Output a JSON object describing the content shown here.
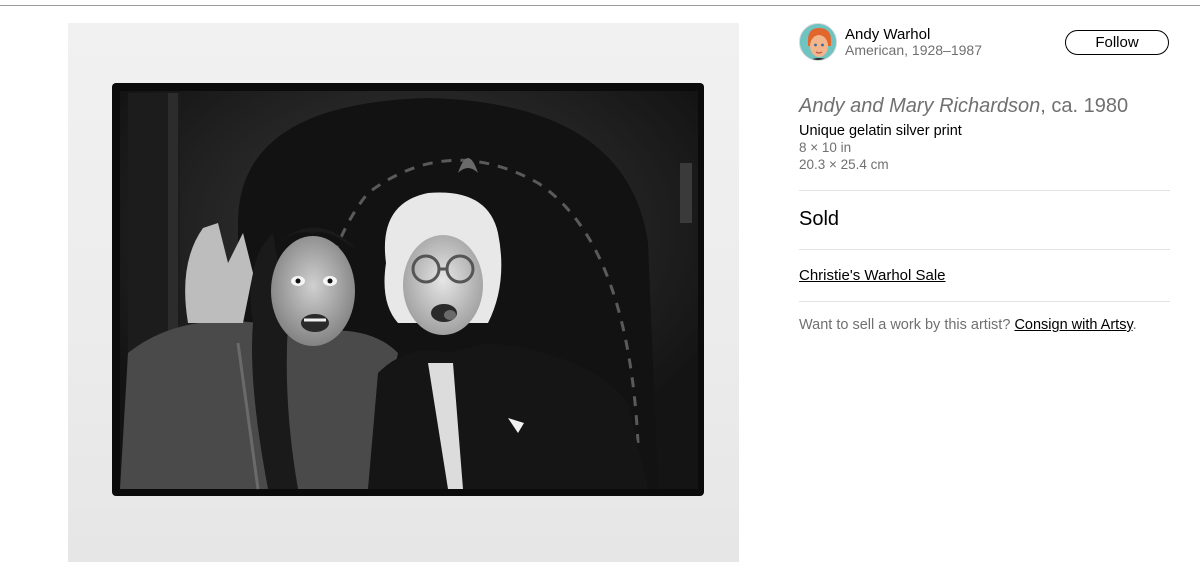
{
  "artist": {
    "name": "Andy Warhol",
    "meta": "American, 1928–1987",
    "follow_label": "Follow"
  },
  "artwork": {
    "title": "Andy and Mary Richardson",
    "date_text": ", ca. 1980",
    "medium": "Unique gelatin silver print",
    "dimensions_in": "8 × 10 in",
    "dimensions_cm": "20.3 × 25.4 cm",
    "status": "Sold",
    "sale_link": "Christie's Warhol Sale"
  },
  "consign": {
    "prompt": "Want to sell a work by this artist? ",
    "link": "Consign with Artsy",
    "suffix": "."
  },
  "colors": {
    "text_primary": "#000000",
    "text_secondary": "#707070",
    "divider": "#e2e2e2",
    "avatar_bg": "#6fc3c0"
  }
}
